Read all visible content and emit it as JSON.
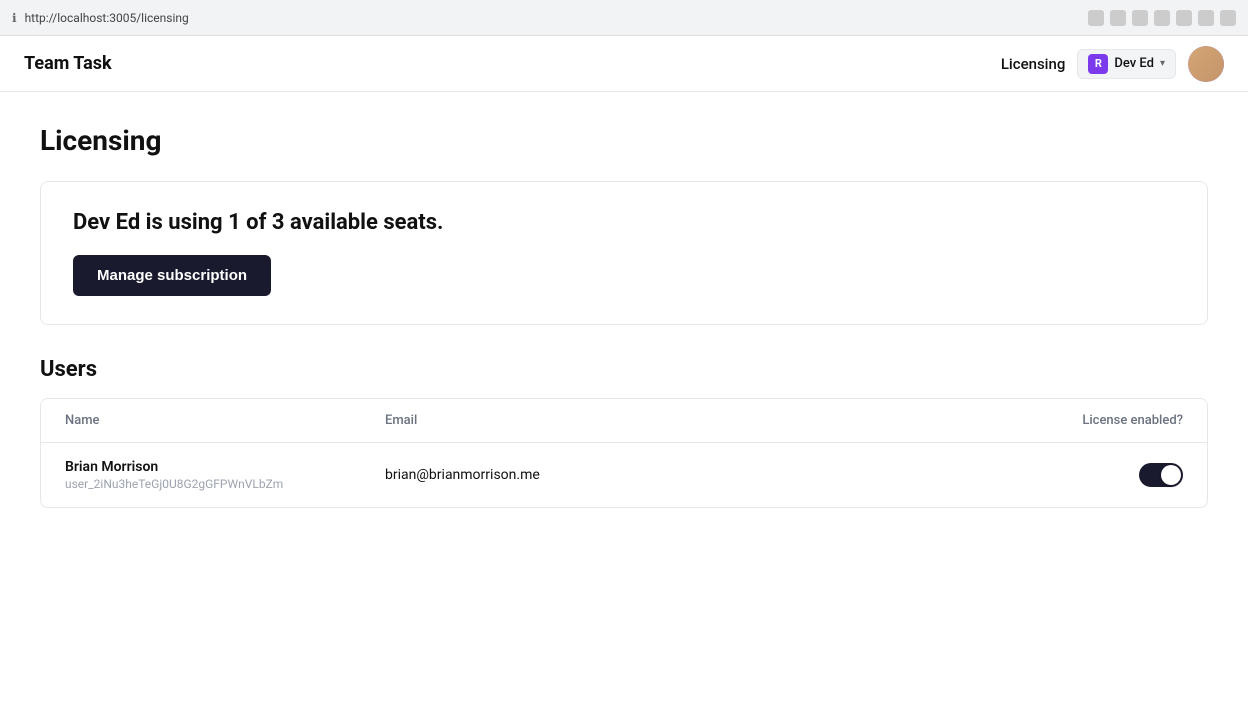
{
  "browser": {
    "url": "http://localhost:3005/licensing"
  },
  "header": {
    "logo": "Team Task",
    "page_title": "Licensing",
    "workspace": {
      "icon_text": "R",
      "name": "Dev Ed",
      "chevron": "▾"
    }
  },
  "page": {
    "title": "Licensing",
    "subscription_card": {
      "text": "Dev Ed is using 1 of 3 available seats.",
      "button_label": "Manage subscription"
    },
    "users_section": {
      "title": "Users",
      "table": {
        "columns": [
          "Name",
          "Email",
          "License enabled?"
        ],
        "rows": [
          {
            "name": "Brian Morrison",
            "user_id": "user_2iNu3heTeGj0U8G2gGFPWnVLbZm",
            "email": "brian@brianmorrison.me",
            "license_enabled": true
          }
        ]
      }
    }
  }
}
